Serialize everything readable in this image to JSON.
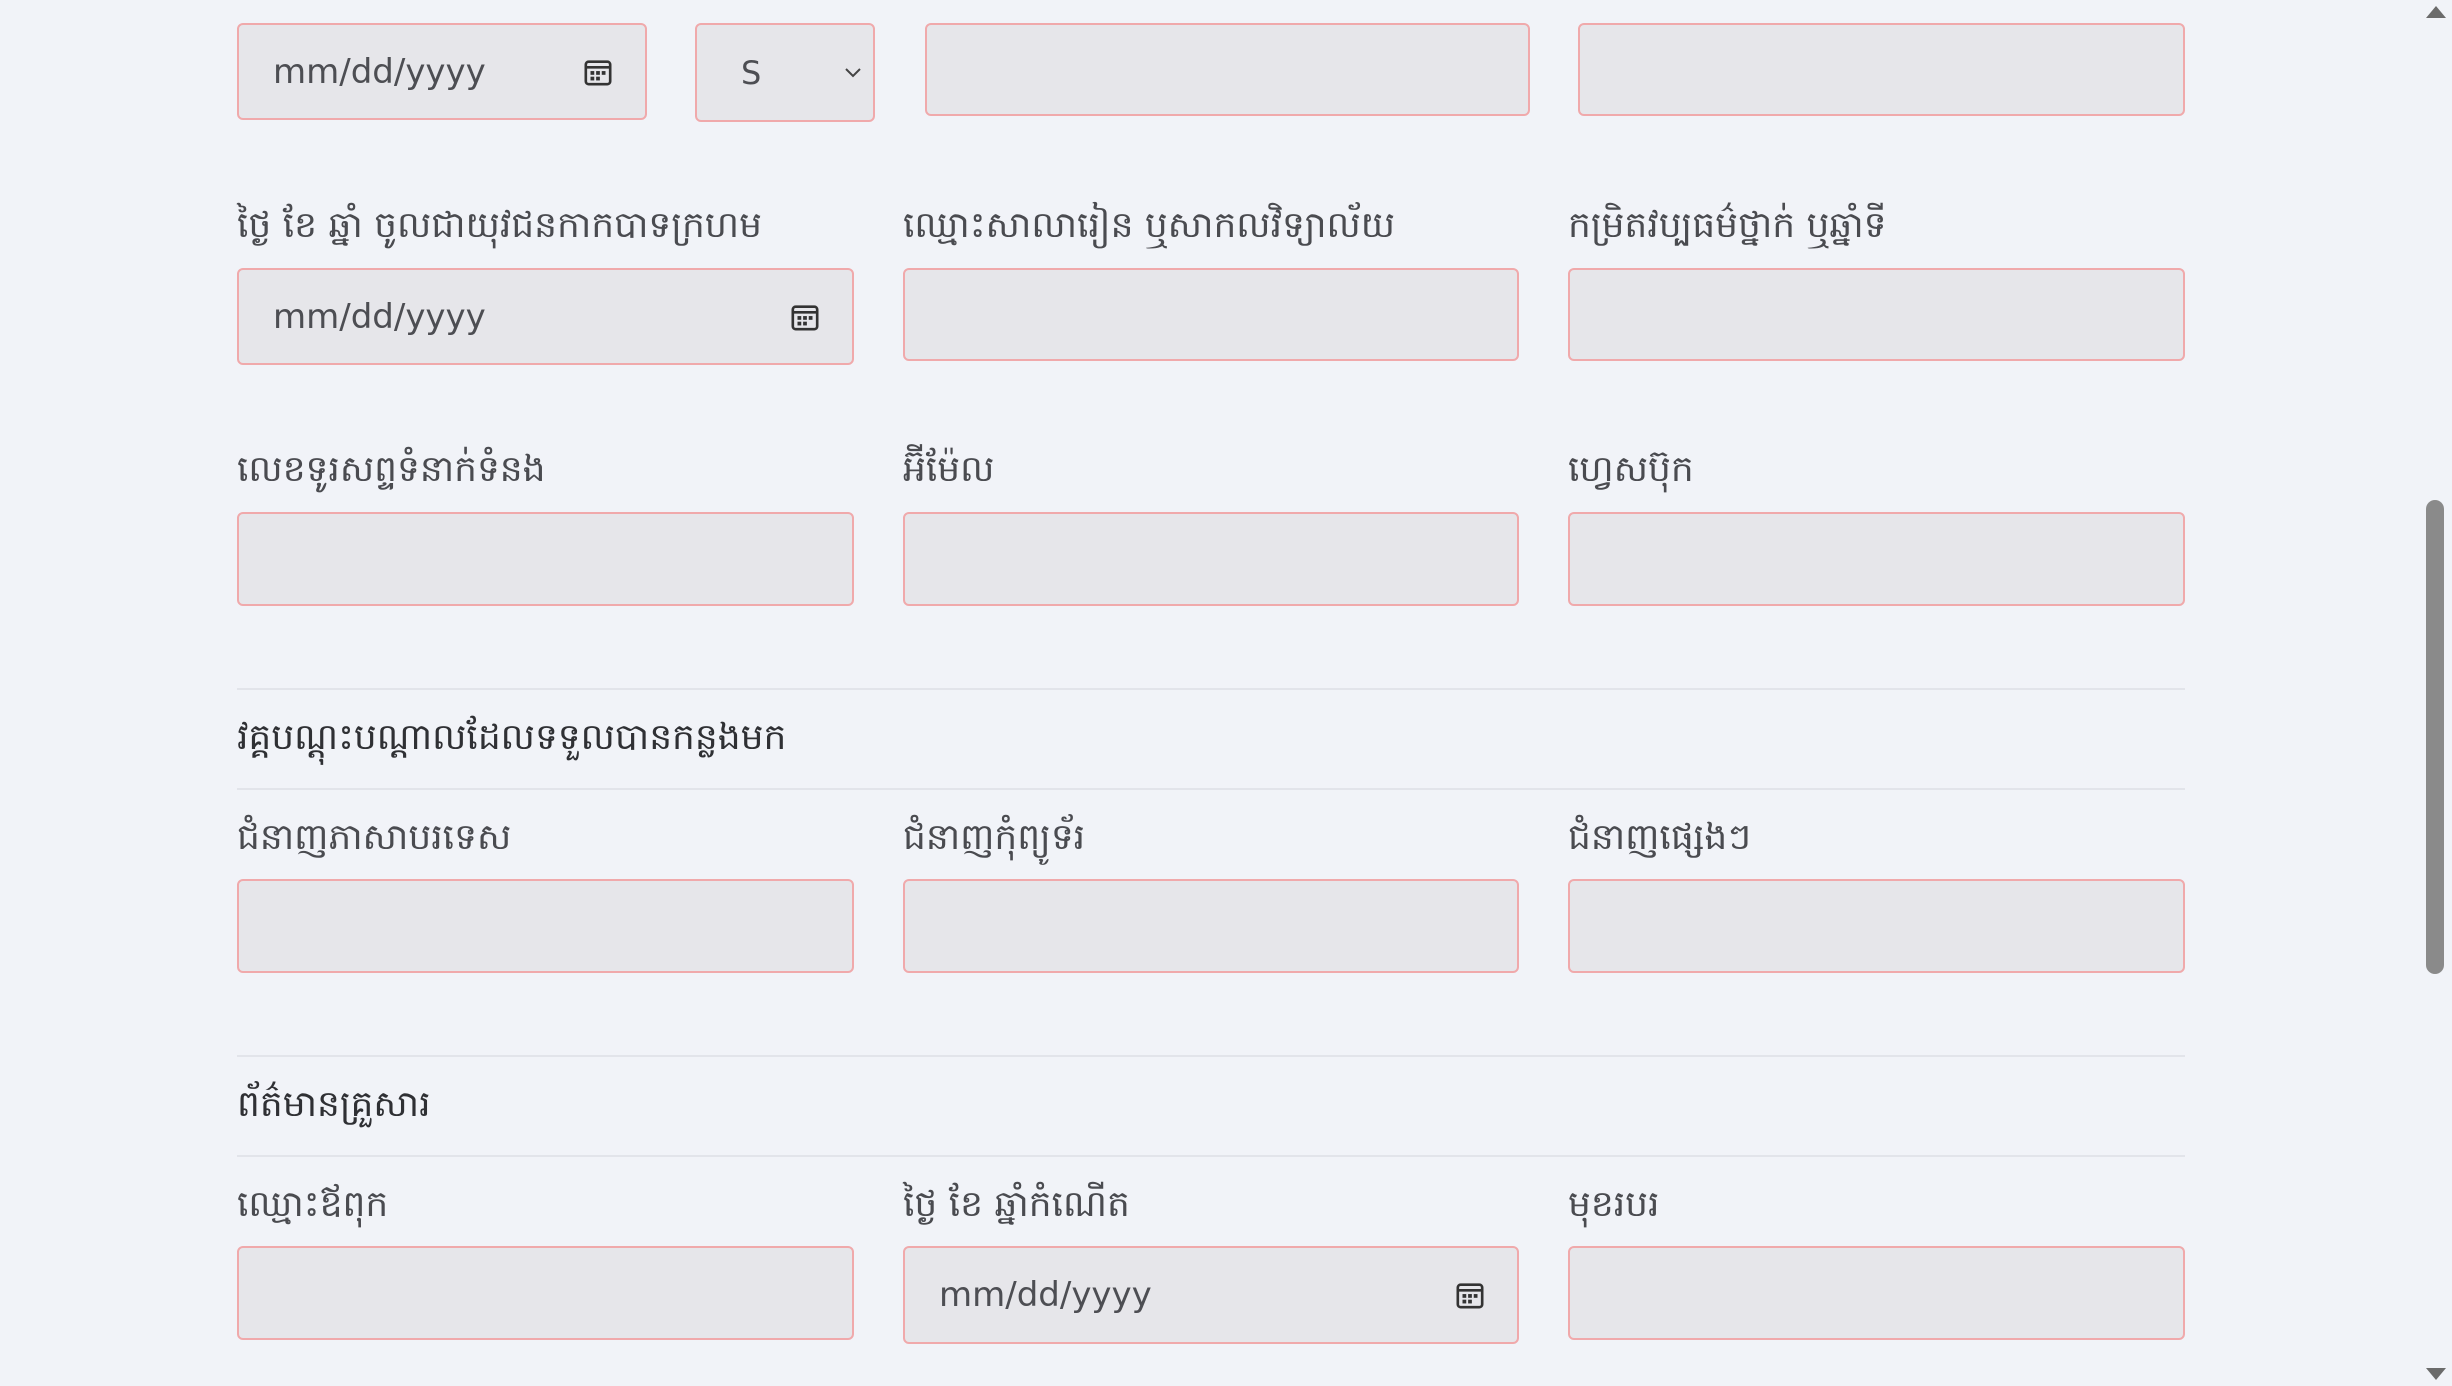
{
  "row0": {
    "date_placeholder": "mm/dd/yyyy",
    "size_select_value": "S"
  },
  "row1": {
    "date_label": "ថ្ងៃ ខែ ឆ្នាំ ចូលជាយុវជនកាកបាទក្រហម",
    "date_placeholder": "mm/dd/yyyy",
    "school_label": "ឈ្មោះសាលារៀន ឬសាកលវិទ្យាល័យ",
    "grade_label": "កម្រិតវប្បធម៌ថ្នាក់ ឬឆ្នាំទី"
  },
  "row2": {
    "phone_label": "លេខទូរសព្ទទំនាក់ទំនង",
    "email_label": "អ៊ីម៉ែល",
    "facebook_label": "ហ្វេសប៊ុក"
  },
  "training": {
    "section_title": "វគ្គបណ្តុះបណ្តាលដែលទទួលបានកន្លងមក",
    "language_label": "ជំនាញភាសាបរទេស",
    "computer_label": "ជំនាញកុំព្យូទ័រ",
    "other_label": "ជំនាញផ្សេងៗ"
  },
  "family": {
    "section_title": "ព័ត៌មានគ្រួសារ",
    "father_name_label": "ឈ្មោះឪពុក",
    "father_dob_label": "ថ្ងៃ ខែ ឆ្នាំកំណើត",
    "father_dob_placeholder": "mm/dd/yyyy",
    "father_job_label": "មុខរបរ"
  }
}
